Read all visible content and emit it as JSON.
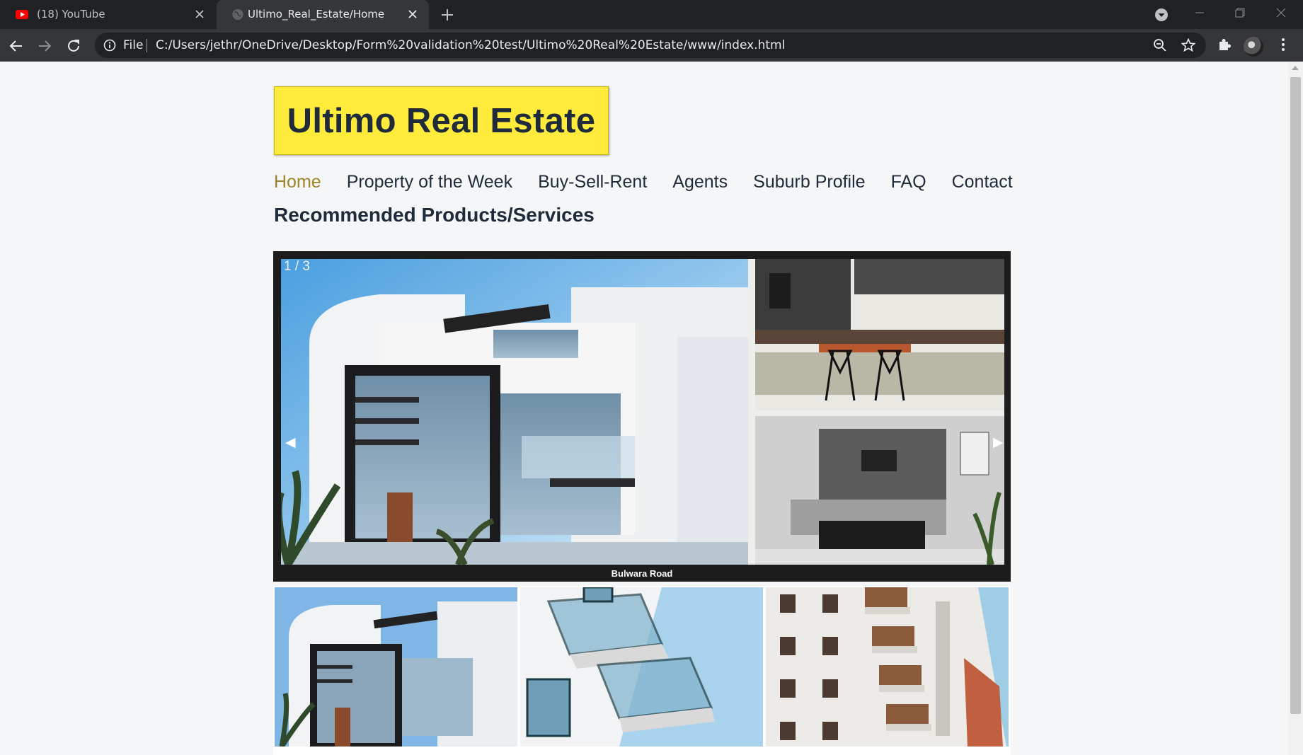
{
  "browser": {
    "tabs": [
      {
        "title": "(18) YouTube",
        "icon": "youtube-icon"
      },
      {
        "title": "Ultimo_Real_Estate/Home",
        "icon": "globe-icon"
      }
    ],
    "address_scheme": "File",
    "url": "C:/Users/jethr/OneDrive/Desktop/Form%20validation%20test/Ultimo%20Real%20Estate/www/index.html"
  },
  "site": {
    "logo": "Ultimo Real Estate",
    "nav": [
      {
        "label": "Home",
        "active": true
      },
      {
        "label": "Property of the Week",
        "active": false
      },
      {
        "label": "Buy-Sell-Rent",
        "active": false
      },
      {
        "label": "Agents",
        "active": false
      },
      {
        "label": "Suburb Profile",
        "active": false
      },
      {
        "label": "FAQ",
        "active": false
      },
      {
        "label": "Contact",
        "active": false
      }
    ],
    "section_title": "Recommended Products/Services",
    "slideshow": {
      "counter": "1 / 3",
      "prev": "◀",
      "next": "▶",
      "caption": "Bulwara Road"
    }
  },
  "colors": {
    "logo_bg": "#ffeb3b",
    "nav_active": "#a08426",
    "text_dark": "#1f2b3a",
    "chrome_dark": "#202124",
    "chrome_mid": "#35363a"
  }
}
